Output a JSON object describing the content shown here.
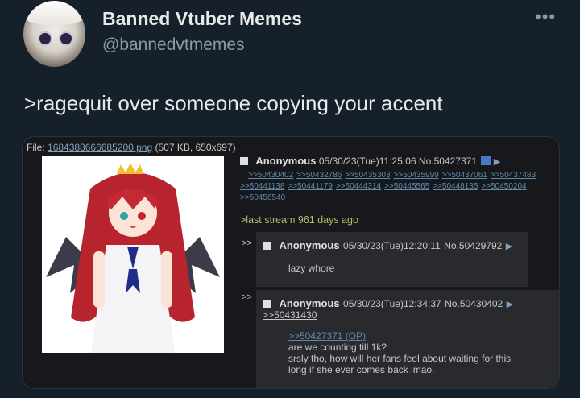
{
  "author": {
    "display_name": "Banned Vtuber Memes",
    "handle": "@bannedvtmemes"
  },
  "tweet": {
    "text": ">ragequit over someone copying your accent"
  },
  "post": {
    "file_label": "File:",
    "file_name": "1684388666685200.png",
    "file_info": "(507 KB, 650x697)",
    "op": {
      "name": "Anonymous",
      "datetime": "05/30/23(Tue)11:25:06",
      "number": "No.50427371",
      "backlinks_row1": [
        ">>50430402",
        ">>50432786",
        ">>50435303",
        ">>50435999",
        ">>50437061",
        ">>50437483"
      ],
      "backlinks_row2": [
        ">>50441138",
        ">>50441179",
        ">>50444314",
        ">>50445565",
        ">>50448135",
        ">>50450204"
      ],
      "backlinks_row3": [
        ">>50456540"
      ],
      "greentext": ">last stream 961 days ago"
    },
    "reply1": {
      "marker": ">>",
      "name": "Anonymous",
      "datetime": "05/30/23(Tue)12:20:11",
      "number": "No.50429792",
      "body": "lazy whore"
    },
    "reply2": {
      "marker": ">>",
      "name": "Anonymous",
      "datetime": "05/30/23(Tue)12:34:37",
      "number": "No.50430402",
      "backlink": ">>50431430",
      "quote": ">>50427371 (OP)",
      "body_line1": "are we counting till 1k?",
      "body_line2": "srsly tho, how will her fans feel about waiting for this",
      "body_line3": "long if she ever comes back lmao."
    }
  },
  "icons": {
    "more": "more-dots-icon",
    "arrow": "triangle-right-icon"
  },
  "colors": {
    "background": "#15202b",
    "greentext": "#b5bd68",
    "link": "#5f89ac"
  }
}
